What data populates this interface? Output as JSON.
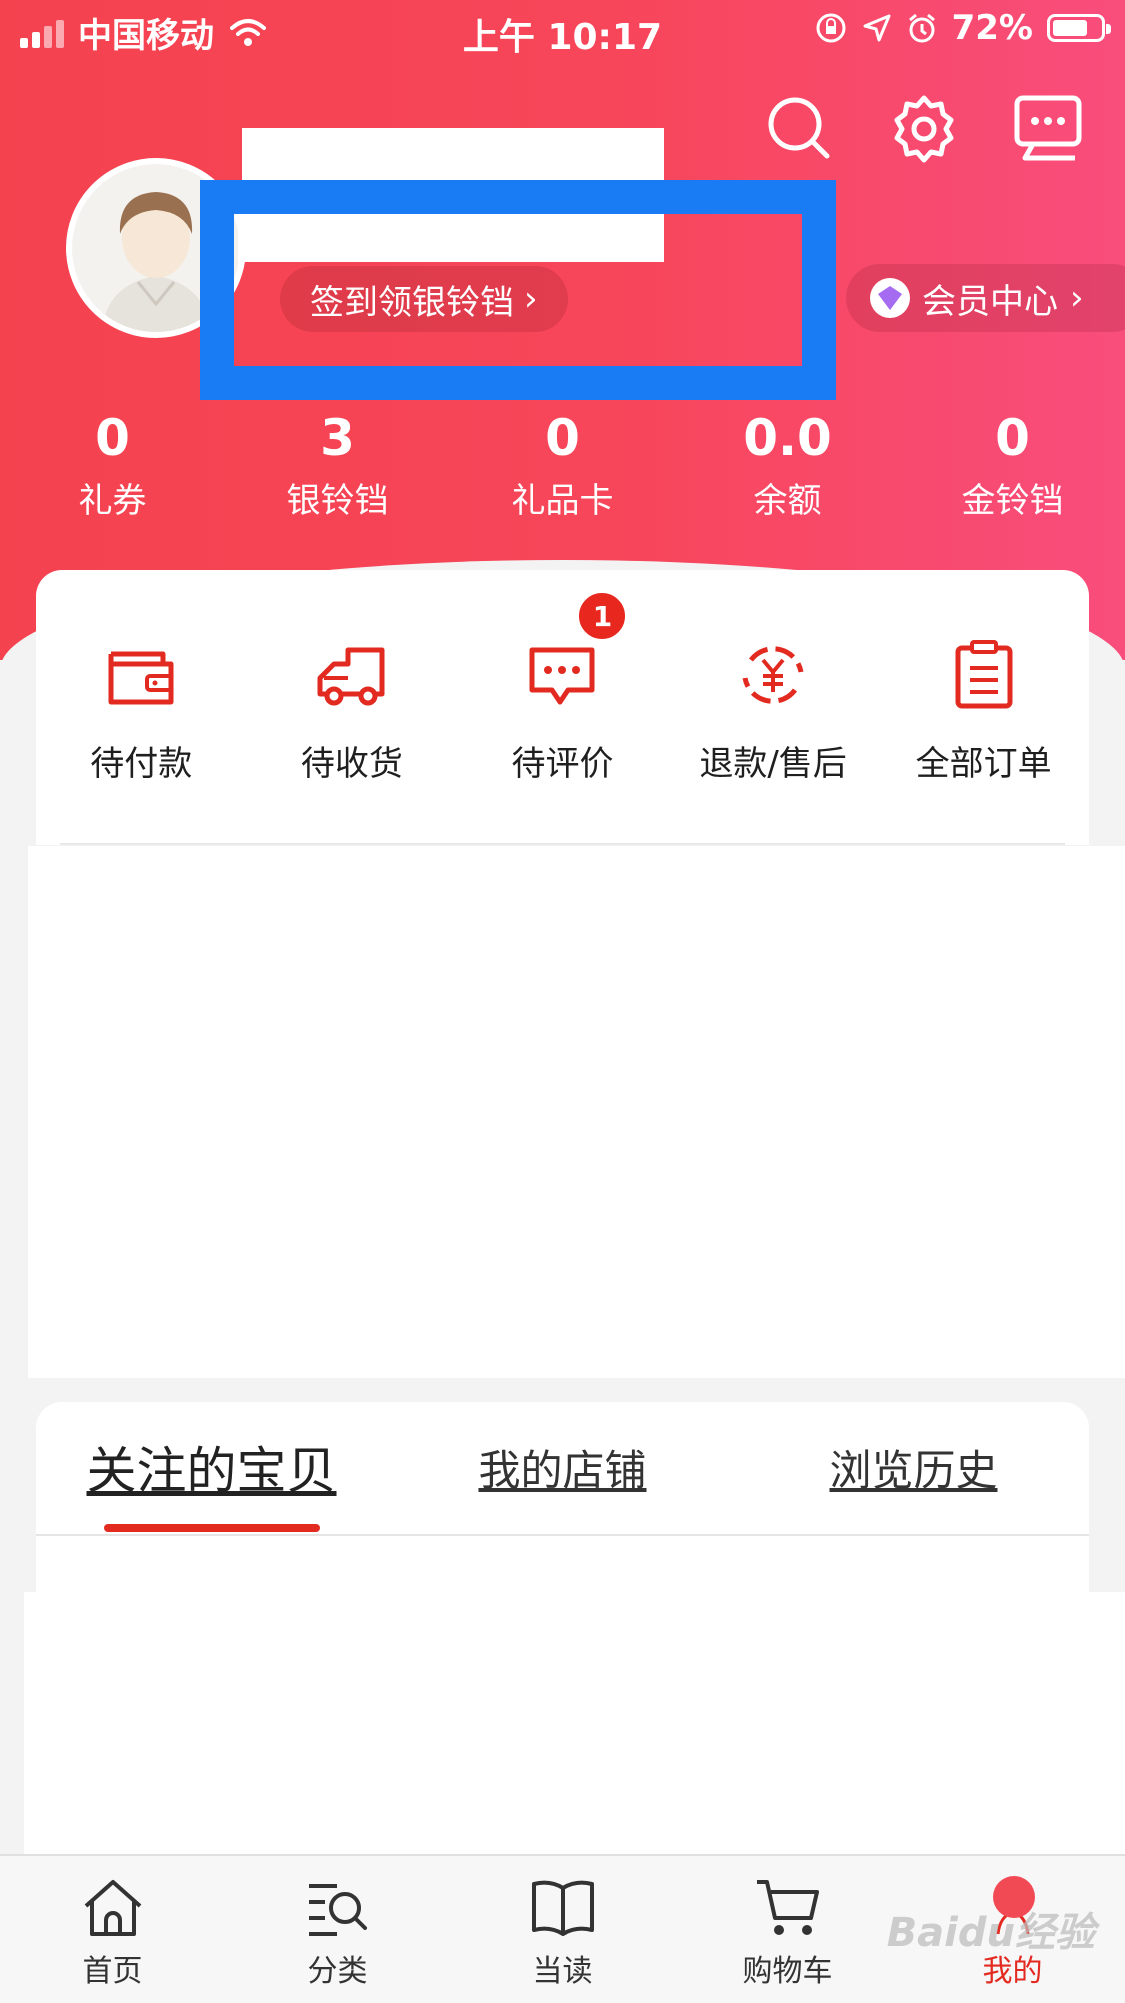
{
  "status_bar": {
    "carrier": "中国移动",
    "time": "上午 10:17",
    "battery": "72%"
  },
  "header": {
    "signin_label": "签到领银铃铛",
    "vip_label": "会员中心"
  },
  "stats": [
    {
      "value": "0",
      "label": "礼券"
    },
    {
      "value": "3",
      "label": "银铃铛"
    },
    {
      "value": "0",
      "label": "礼品卡"
    },
    {
      "value": "0.0",
      "label": "余额"
    },
    {
      "value": "0",
      "label": "金铃铛"
    }
  ],
  "orders": [
    {
      "label": "待付款",
      "icon": "wallet-icon"
    },
    {
      "label": "待收货",
      "icon": "truck-icon"
    },
    {
      "label": "待评价",
      "icon": "comment-icon",
      "badge": "1"
    },
    {
      "label": "退款/售后",
      "icon": "refund-icon"
    },
    {
      "label": "全部订单",
      "icon": "orders-list-icon"
    }
  ],
  "tabs": [
    {
      "label": "关注的宝贝",
      "active": true
    },
    {
      "label": "我的店铺"
    },
    {
      "label": "浏览历史"
    }
  ],
  "tabbar": [
    {
      "label": "首页",
      "icon": "home-icon"
    },
    {
      "label": "分类",
      "icon": "category-icon"
    },
    {
      "label": "当读",
      "icon": "book-icon"
    },
    {
      "label": "购物车",
      "icon": "cart-icon"
    },
    {
      "label": "我的",
      "icon": "profile-icon",
      "active": true
    }
  ],
  "watermark": "Baidu经验",
  "colors": {
    "header_start": "#f5424f",
    "header_end": "#f94d7c",
    "accent": "#e32a20",
    "highlight_box": "#1a7cf4"
  }
}
